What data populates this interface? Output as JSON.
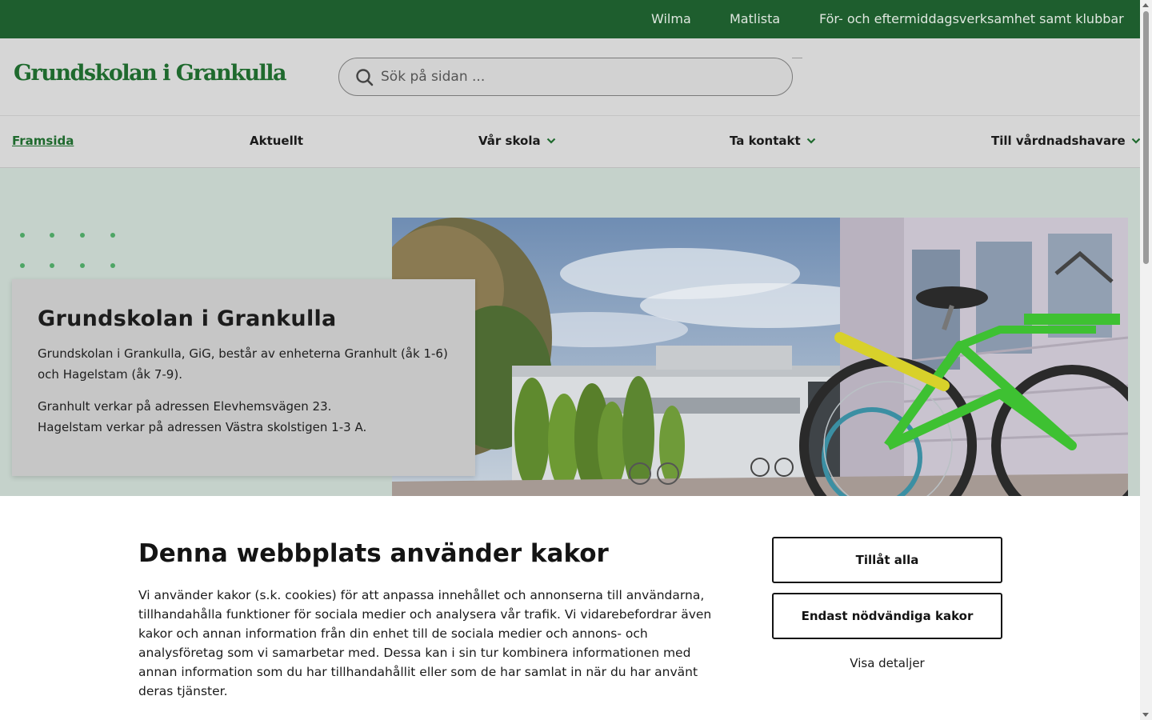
{
  "topbar": {
    "links": [
      "Wilma",
      "Matlista",
      "För- och eftermiddagsverksamhet samt klubbar"
    ]
  },
  "header": {
    "logo_text": "Grundskolan i Grankulla",
    "search_placeholder": "Sök på sidan ..."
  },
  "nav": {
    "items": [
      {
        "label": "Framsida",
        "active": true,
        "has_dropdown": false
      },
      {
        "label": "Aktuellt",
        "active": false,
        "has_dropdown": false
      },
      {
        "label": "Vår skola",
        "active": false,
        "has_dropdown": true
      },
      {
        "label": "Ta kontakt",
        "active": false,
        "has_dropdown": true
      },
      {
        "label": "Till vårdnadshavare",
        "active": false,
        "has_dropdown": true
      }
    ]
  },
  "hero": {
    "title": "Grundskolan i Grankulla",
    "paragraph1": "Grundskolan i Grankulla, GiG, består av enheterna Granhult (åk 1-6) och Hagelstam (åk 7-9).",
    "line_granhult": "Granhult verkar på adressen Elevhemsvägen 23.",
    "line_hagelstam": "Hagelstam verkar på adressen Västra skolstigen 1-3 A."
  },
  "cookie": {
    "title": "Denna webbplats använder kakor",
    "text": "Vi använder kakor (s.k. cookies) för att anpassa innehållet och annonserna till användarna, tillhandahålla funktioner för sociala medier och analysera vår trafik. Vi vidarebefordrar även kakor och annan information från din enhet till de sociala medier och annons- och analysföretag som vi samarbetar med. Dessa kan i sin tur kombinera informationen med annan information som du har tillhandahållit eller som de har samlat in när du har använt deras tjänster.",
    "allow_all": "Tillåt alla",
    "necessary_only": "Endast nödvändiga kakor",
    "show_details": "Visa detaljer"
  },
  "colors": {
    "brand_green": "#1e5e2e",
    "accent_green": "#4ea565"
  }
}
